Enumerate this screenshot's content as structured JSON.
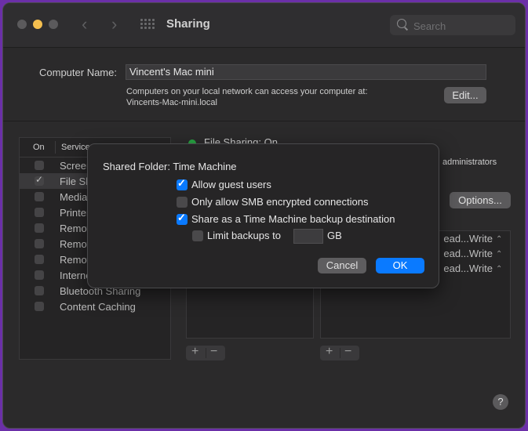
{
  "window": {
    "title": "Sharing",
    "search_placeholder": "Search"
  },
  "computer_name": {
    "label": "Computer Name:",
    "value": "Vincent's Mac mini",
    "description_line1": "Computers on your local network can access your computer at:",
    "description_line2": "Vincents-Mac-mini.local",
    "edit_label": "Edit..."
  },
  "services": {
    "header_on": "On",
    "header_service": "Service",
    "items": [
      {
        "label": "Screen Sharing",
        "checked": false
      },
      {
        "label": "File Sharing",
        "checked": true
      },
      {
        "label": "Media Sharing",
        "checked": false
      },
      {
        "label": "Printer Sharing",
        "checked": false
      },
      {
        "label": "Remote Login",
        "checked": false
      },
      {
        "label": "Remote Management",
        "checked": false
      },
      {
        "label": "Remote Apple Events",
        "checked": false
      },
      {
        "label": "Internet Sharing",
        "checked": false
      },
      {
        "label": "Bluetooth Sharing",
        "checked": false
      },
      {
        "label": "Content Caching",
        "checked": false
      }
    ]
  },
  "file_sharing": {
    "status": "File Sharing: On",
    "admin_text": "administrators",
    "options_label": "Options...",
    "permissions": [
      "Read & Write",
      "Read & Write",
      "Read & Write"
    ],
    "permission_visible": "ead...Write"
  },
  "dialog": {
    "title": "Shared Folder: Time Machine",
    "options": [
      {
        "label": "Allow guest users",
        "checked": true
      },
      {
        "label": "Only allow SMB encrypted connections",
        "checked": false
      },
      {
        "label": "Share as a Time Machine backup destination",
        "checked": true
      }
    ],
    "limit_label": "Limit backups to",
    "limit_checked": false,
    "limit_value": "",
    "limit_unit": "GB",
    "cancel_label": "Cancel",
    "ok_label": "OK"
  },
  "controls": {
    "plus": "+",
    "minus": "−",
    "help": "?"
  },
  "colors": {
    "accent": "#0a7aff",
    "status_on": "#29a644"
  }
}
